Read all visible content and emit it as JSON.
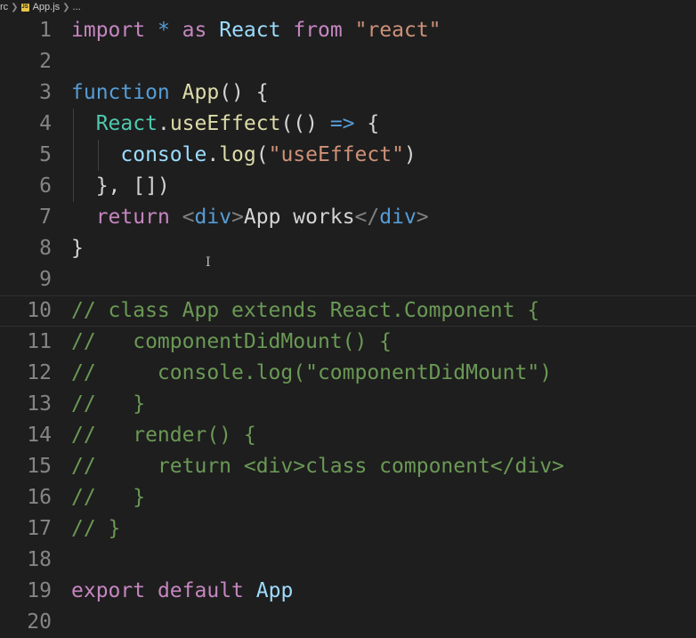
{
  "breadcrumb": {
    "folder": "rc",
    "icon": "javascript-file-icon",
    "icon_text": "JS",
    "file": "App.js",
    "more": "..."
  },
  "editor": {
    "lines": [
      {
        "n": "1",
        "tokens": [
          {
            "t": "import",
            "c": "kw-ctrl"
          },
          {
            "t": " ",
            "c": "pun"
          },
          {
            "t": "*",
            "c": "kw"
          },
          {
            "t": " ",
            "c": "pun"
          },
          {
            "t": "as",
            "c": "kw-ctrl"
          },
          {
            "t": " ",
            "c": "pun"
          },
          {
            "t": "React",
            "c": "var"
          },
          {
            "t": " ",
            "c": "pun"
          },
          {
            "t": "from",
            "c": "kw-ctrl"
          },
          {
            "t": " ",
            "c": "pun"
          },
          {
            "t": "\"react\"",
            "c": "str"
          }
        ]
      },
      {
        "n": "2",
        "tokens": []
      },
      {
        "n": "3",
        "tokens": [
          {
            "t": "function",
            "c": "kw"
          },
          {
            "t": " ",
            "c": "pun"
          },
          {
            "t": "App",
            "c": "fn"
          },
          {
            "t": "() {",
            "c": "pun"
          }
        ]
      },
      {
        "n": "4",
        "tokens": [
          {
            "t": "  ",
            "c": "pun"
          },
          {
            "t": "React",
            "c": "cls"
          },
          {
            "t": ".",
            "c": "pun"
          },
          {
            "t": "useEffect",
            "c": "fn"
          },
          {
            "t": "(() ",
            "c": "pun"
          },
          {
            "t": "=>",
            "c": "kw"
          },
          {
            "t": " {",
            "c": "pun"
          }
        ]
      },
      {
        "n": "5",
        "tokens": [
          {
            "t": "    ",
            "c": "pun"
          },
          {
            "t": "console",
            "c": "var"
          },
          {
            "t": ".",
            "c": "pun"
          },
          {
            "t": "log",
            "c": "fn"
          },
          {
            "t": "(",
            "c": "pun"
          },
          {
            "t": "\"useEffect\"",
            "c": "str"
          },
          {
            "t": ")",
            "c": "pun"
          }
        ]
      },
      {
        "n": "6",
        "tokens": [
          {
            "t": "  }, [])",
            "c": "pun"
          }
        ]
      },
      {
        "n": "7",
        "tokens": [
          {
            "t": "  ",
            "c": "pun"
          },
          {
            "t": "return",
            "c": "kw-ctrl"
          },
          {
            "t": " ",
            "c": "pun"
          },
          {
            "t": "<",
            "c": "tagp"
          },
          {
            "t": "div",
            "c": "tag"
          },
          {
            "t": ">",
            "c": "tagp"
          },
          {
            "t": "App works",
            "c": "pun"
          },
          {
            "t": "</",
            "c": "tagp"
          },
          {
            "t": "div",
            "c": "tag"
          },
          {
            "t": ">",
            "c": "tagp"
          }
        ]
      },
      {
        "n": "8",
        "tokens": [
          {
            "t": "}",
            "c": "pun"
          }
        ]
      },
      {
        "n": "9",
        "tokens": []
      },
      {
        "n": "10",
        "active": true,
        "tokens": [
          {
            "t": "// class App extends React.Component {",
            "c": "cmt"
          }
        ]
      },
      {
        "n": "11",
        "tokens": [
          {
            "t": "//   componentDidMount() {",
            "c": "cmt"
          }
        ]
      },
      {
        "n": "12",
        "tokens": [
          {
            "t": "//     console.log(\"componentDidMount\")",
            "c": "cmt"
          }
        ]
      },
      {
        "n": "13",
        "tokens": [
          {
            "t": "//   }",
            "c": "cmt"
          }
        ]
      },
      {
        "n": "14",
        "tokens": [
          {
            "t": "//   render() {",
            "c": "cmt"
          }
        ]
      },
      {
        "n": "15",
        "tokens": [
          {
            "t": "//     return <div>class component</div>",
            "c": "cmt"
          }
        ]
      },
      {
        "n": "16",
        "tokens": [
          {
            "t": "//   }",
            "c": "cmt"
          }
        ]
      },
      {
        "n": "17",
        "tokens": [
          {
            "t": "// }",
            "c": "cmt"
          }
        ]
      },
      {
        "n": "18",
        "tokens": []
      },
      {
        "n": "19",
        "tokens": [
          {
            "t": "export",
            "c": "kw-ctrl"
          },
          {
            "t": " ",
            "c": "pun"
          },
          {
            "t": "default",
            "c": "kw-ctrl"
          },
          {
            "t": " ",
            "c": "pun"
          },
          {
            "t": "App",
            "c": "var"
          }
        ]
      },
      {
        "n": "20",
        "tokens": []
      }
    ]
  },
  "colors": {
    "background": "#1e1e1e",
    "line_number": "#858585",
    "keyword_control": "#c586c0",
    "keyword": "#569cd6",
    "function": "#dcdcaa",
    "variable": "#9cdcfe",
    "class": "#4ec9b0",
    "string": "#ce9178",
    "comment": "#6a9955"
  },
  "mouse_cursor_icon": "text-cursor-icon"
}
